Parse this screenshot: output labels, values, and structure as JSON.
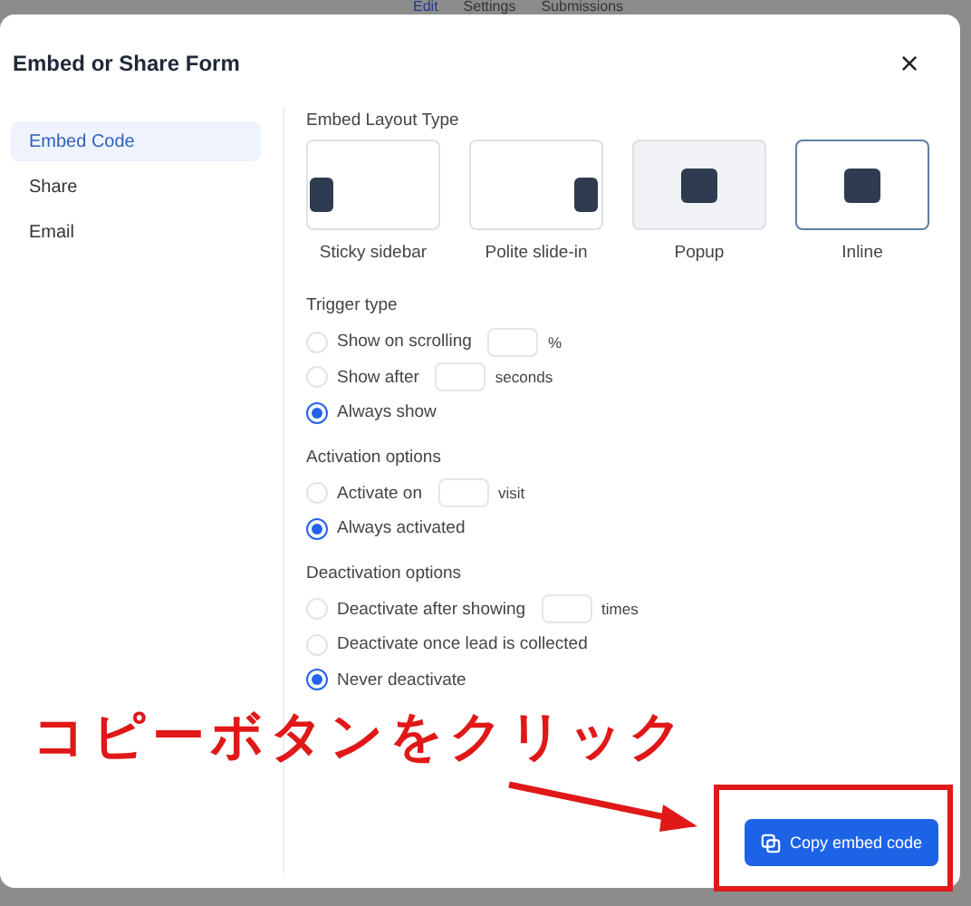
{
  "background_tabs": [
    {
      "label": "Edit",
      "selected": true
    },
    {
      "label": "Settings",
      "selected": false
    },
    {
      "label": "Submissions",
      "selected": false
    }
  ],
  "dialog": {
    "title": "Embed or Share Form",
    "close": "×"
  },
  "sidebar": {
    "items": [
      {
        "label": "Embed Code",
        "selected": true
      },
      {
        "label": "Share",
        "selected": false
      },
      {
        "label": "Email",
        "selected": false
      }
    ]
  },
  "embed_layout": {
    "heading": "Embed Layout Type",
    "options": [
      {
        "label": "Sticky sidebar",
        "kind": "left",
        "selected": false,
        "hovered": false
      },
      {
        "label": "Polite slide-in",
        "kind": "right",
        "selected": false,
        "hovered": false
      },
      {
        "label": "Popup",
        "kind": "center",
        "selected": false,
        "hovered": true
      },
      {
        "label": "Inline",
        "kind": "center",
        "selected": true,
        "hovered": false
      }
    ]
  },
  "sections": [
    {
      "heading": "Trigger type",
      "options": [
        {
          "label": "Show on scrolling",
          "kind": "input",
          "unit": "%",
          "selected": false
        },
        {
          "label": "Show after",
          "kind": "input",
          "unit": "seconds",
          "selected": false
        },
        {
          "label": "Always show",
          "kind": "plain",
          "selected": true
        }
      ]
    },
    {
      "heading": "Activation options",
      "options": [
        {
          "label": "Activate on",
          "kind": "input",
          "unit": "visit",
          "selected": false
        },
        {
          "label": "Always activated",
          "kind": "plain",
          "selected": true
        }
      ]
    },
    {
      "heading": "Deactivation options",
      "options": [
        {
          "label": "Deactivate after showing",
          "kind": "input",
          "unit": "times",
          "selected": false
        },
        {
          "label": "Deactivate once lead is collected",
          "kind": "plain",
          "selected": false
        },
        {
          "label": "Never deactivate",
          "kind": "plain",
          "selected": true
        }
      ]
    }
  ],
  "footer": {
    "button": "Copy embed code"
  },
  "annotation": {
    "text": "コピーボタンをクリック"
  }
}
